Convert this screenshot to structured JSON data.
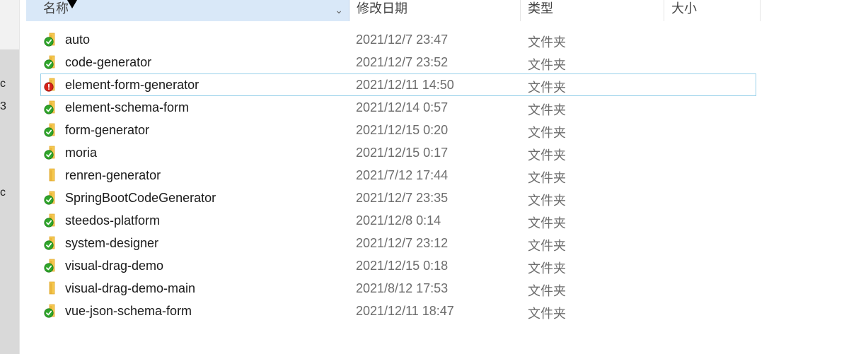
{
  "left_fragments": [
    "c",
    "3",
    "c"
  ],
  "columns": {
    "name": "名称",
    "date": "修改日期",
    "type": "类型",
    "size": "大小"
  },
  "rows": [
    {
      "name": "auto",
      "date": "2021/12/7 23:47",
      "type": "文件夹",
      "status": "ok"
    },
    {
      "name": "code-generator",
      "date": "2021/12/7 23:52",
      "type": "文件夹",
      "status": "ok"
    },
    {
      "name": "element-form-generator",
      "date": "2021/12/11 14:50",
      "type": "文件夹",
      "status": "modified"
    },
    {
      "name": "element-schema-form",
      "date": "2021/12/14 0:57",
      "type": "文件夹",
      "status": "ok"
    },
    {
      "name": "form-generator",
      "date": "2021/12/15 0:20",
      "type": "文件夹",
      "status": "ok"
    },
    {
      "name": "moria",
      "date": "2021/12/15 0:17",
      "type": "文件夹",
      "status": "ok"
    },
    {
      "name": "renren-generator",
      "date": "2021/7/12 17:44",
      "type": "文件夹",
      "status": "none"
    },
    {
      "name": "SpringBootCodeGenerator",
      "date": "2021/12/7 23:35",
      "type": "文件夹",
      "status": "ok"
    },
    {
      "name": "steedos-platform",
      "date": "2021/12/8 0:14",
      "type": "文件夹",
      "status": "ok"
    },
    {
      "name": "system-designer",
      "date": "2021/12/7 23:12",
      "type": "文件夹",
      "status": "ok"
    },
    {
      "name": "visual-drag-demo",
      "date": "2021/12/15 0:18",
      "type": "文件夹",
      "status": "ok"
    },
    {
      "name": "visual-drag-demo-main",
      "date": "2021/8/12 17:53",
      "type": "文件夹",
      "status": "none"
    },
    {
      "name": "vue-json-schema-form",
      "date": "2021/12/11 18:47",
      "type": "文件夹",
      "status": "ok"
    }
  ],
  "selected_row": "element-form-generator",
  "colors": {
    "folder": "#f6c94f",
    "folder_dark": "#e0a82e",
    "status_ok": "#2fa52a",
    "status_modified": "#d62318",
    "selection_border": "#99d1ea",
    "header_active_bg": "#d9e8f8"
  }
}
